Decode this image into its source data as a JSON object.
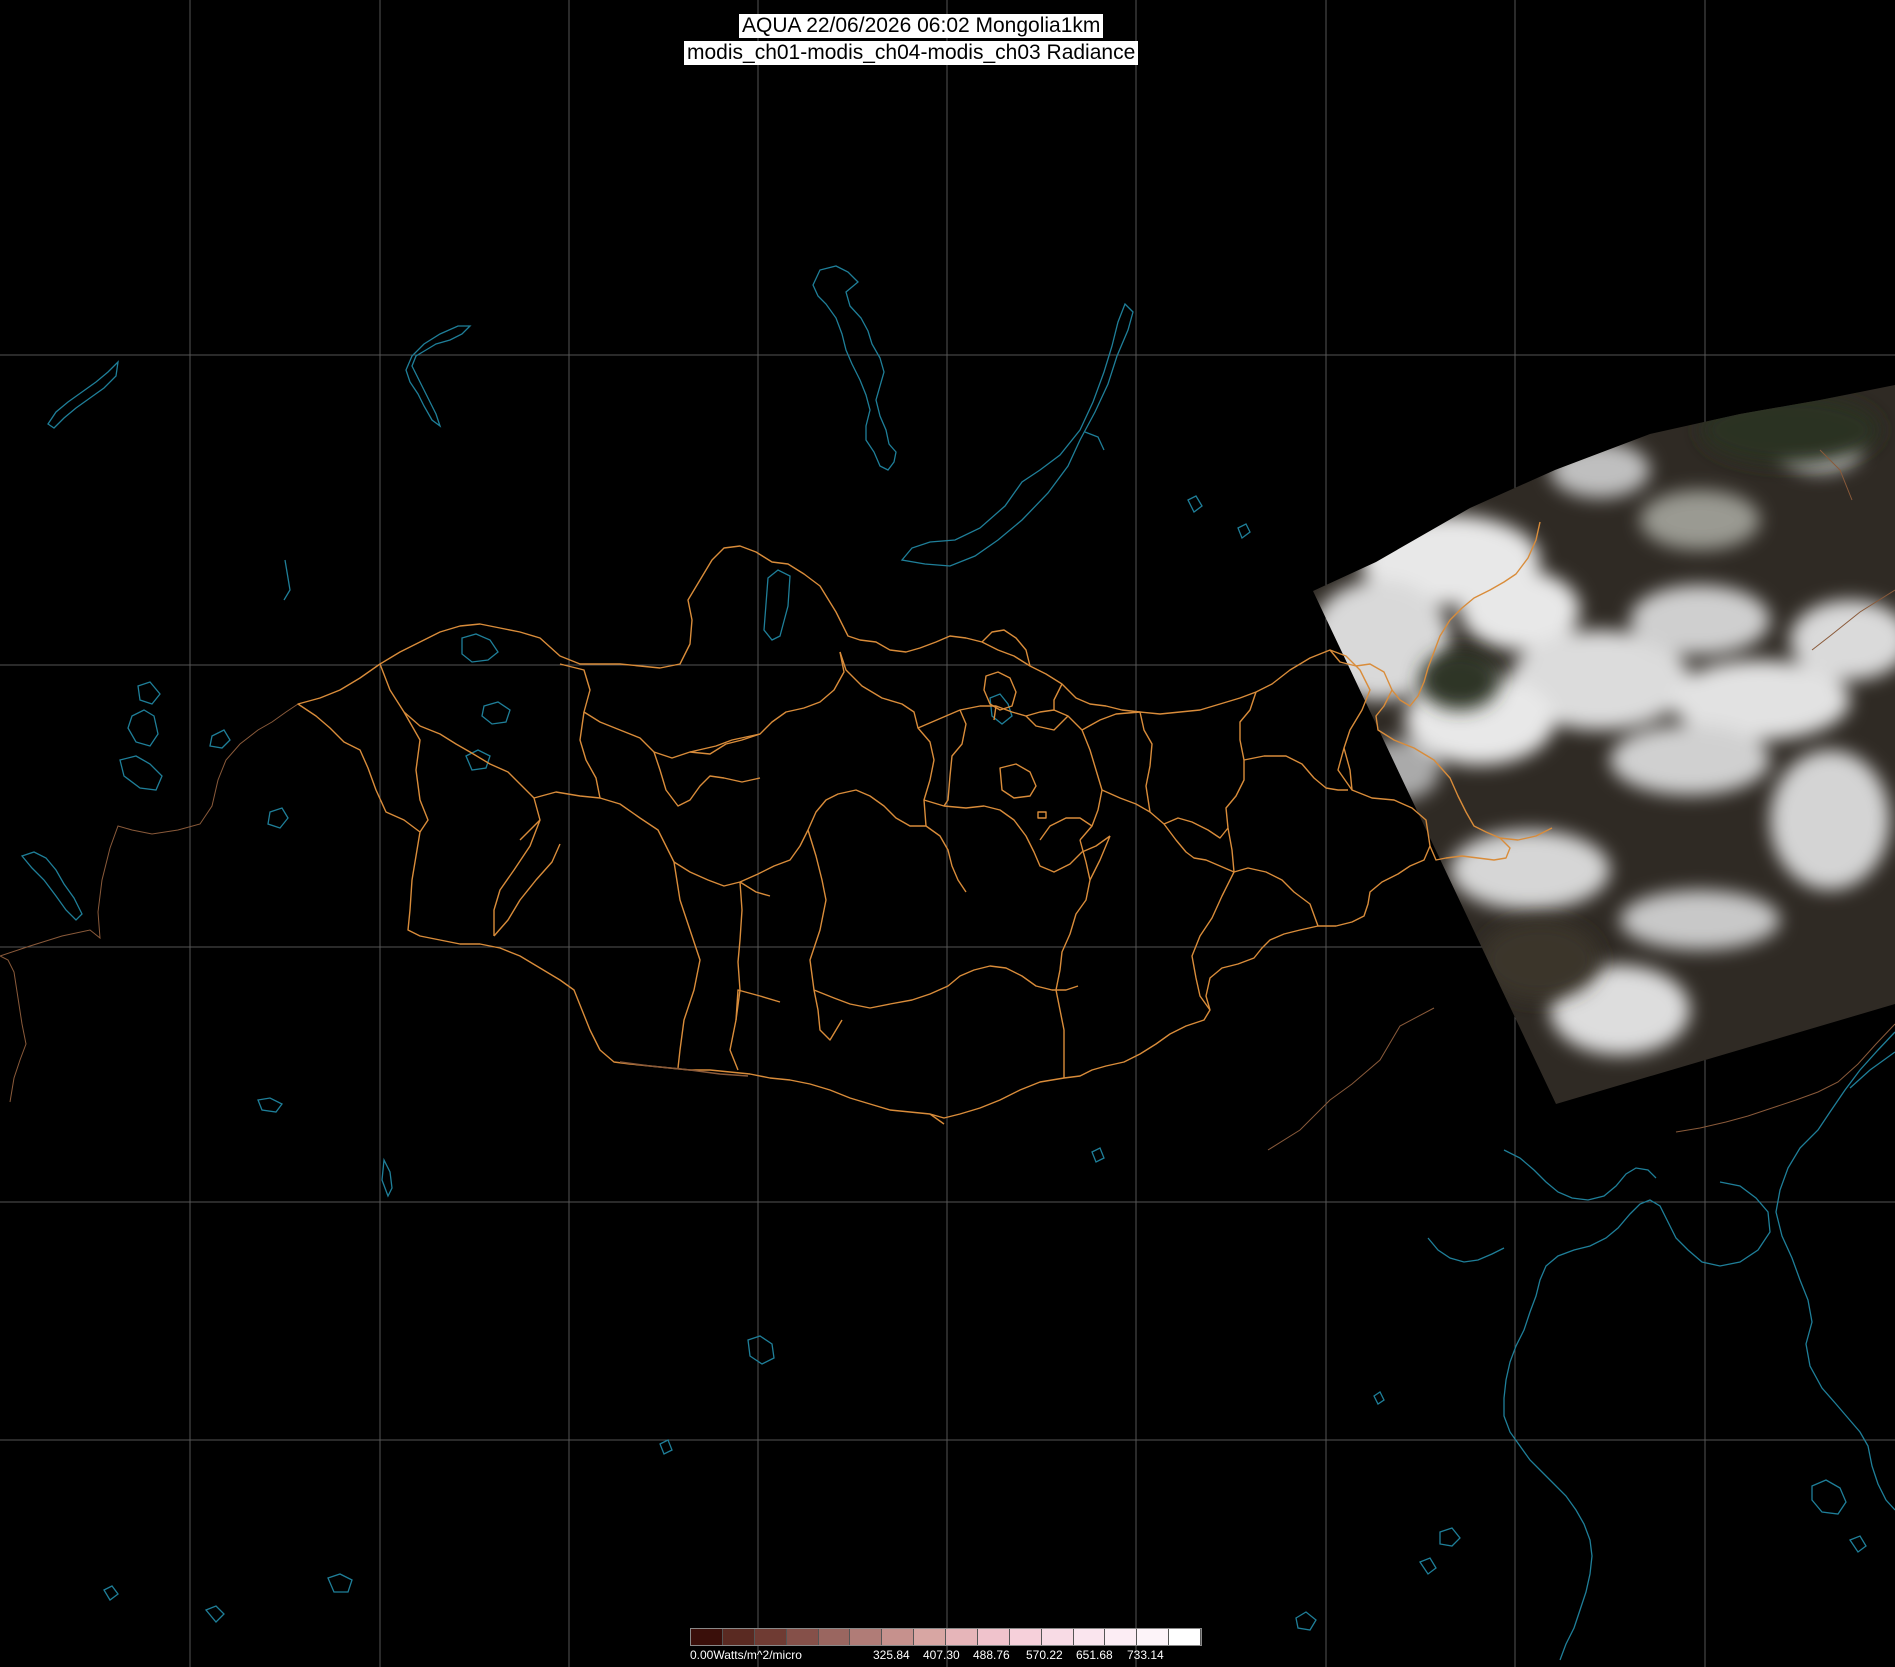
{
  "title": {
    "line1": "AQUA 22/06/2026 06:02 Mongolia1km",
    "line2": "modis_ch01-modis_ch04-modis_ch03 Radiance"
  },
  "colorbar": {
    "unit_label": "0.00Watts/m^2/micro",
    "tick_labels": [
      "325.84",
      "407.30",
      "488.76",
      "570.22",
      "651.68",
      "733.14"
    ],
    "swatch_colors": [
      "#3a0f0a",
      "#5a2a22",
      "#6f3b33",
      "#855049",
      "#9a6660",
      "#b07c77",
      "#c6918d",
      "#d8a6a3",
      "#e6b5b9",
      "#f0c3cc",
      "#f6d0da",
      "#f8dbe5",
      "#fae5ee",
      "#fcedf4",
      "#fdf4f9",
      "#ffffff"
    ]
  },
  "colors": {
    "background": "#000000",
    "graticule": "#555555",
    "coastline": "#1f7f99",
    "admin_border": "#d98c3a",
    "country_border": "#8a5a3a"
  },
  "features": {
    "graticule": "graticule",
    "admin_borders": "mongolia-aimag-borders",
    "coastlines": "coastlines-and-lakes",
    "satellite_swath": "satellite-swath-imagery"
  }
}
